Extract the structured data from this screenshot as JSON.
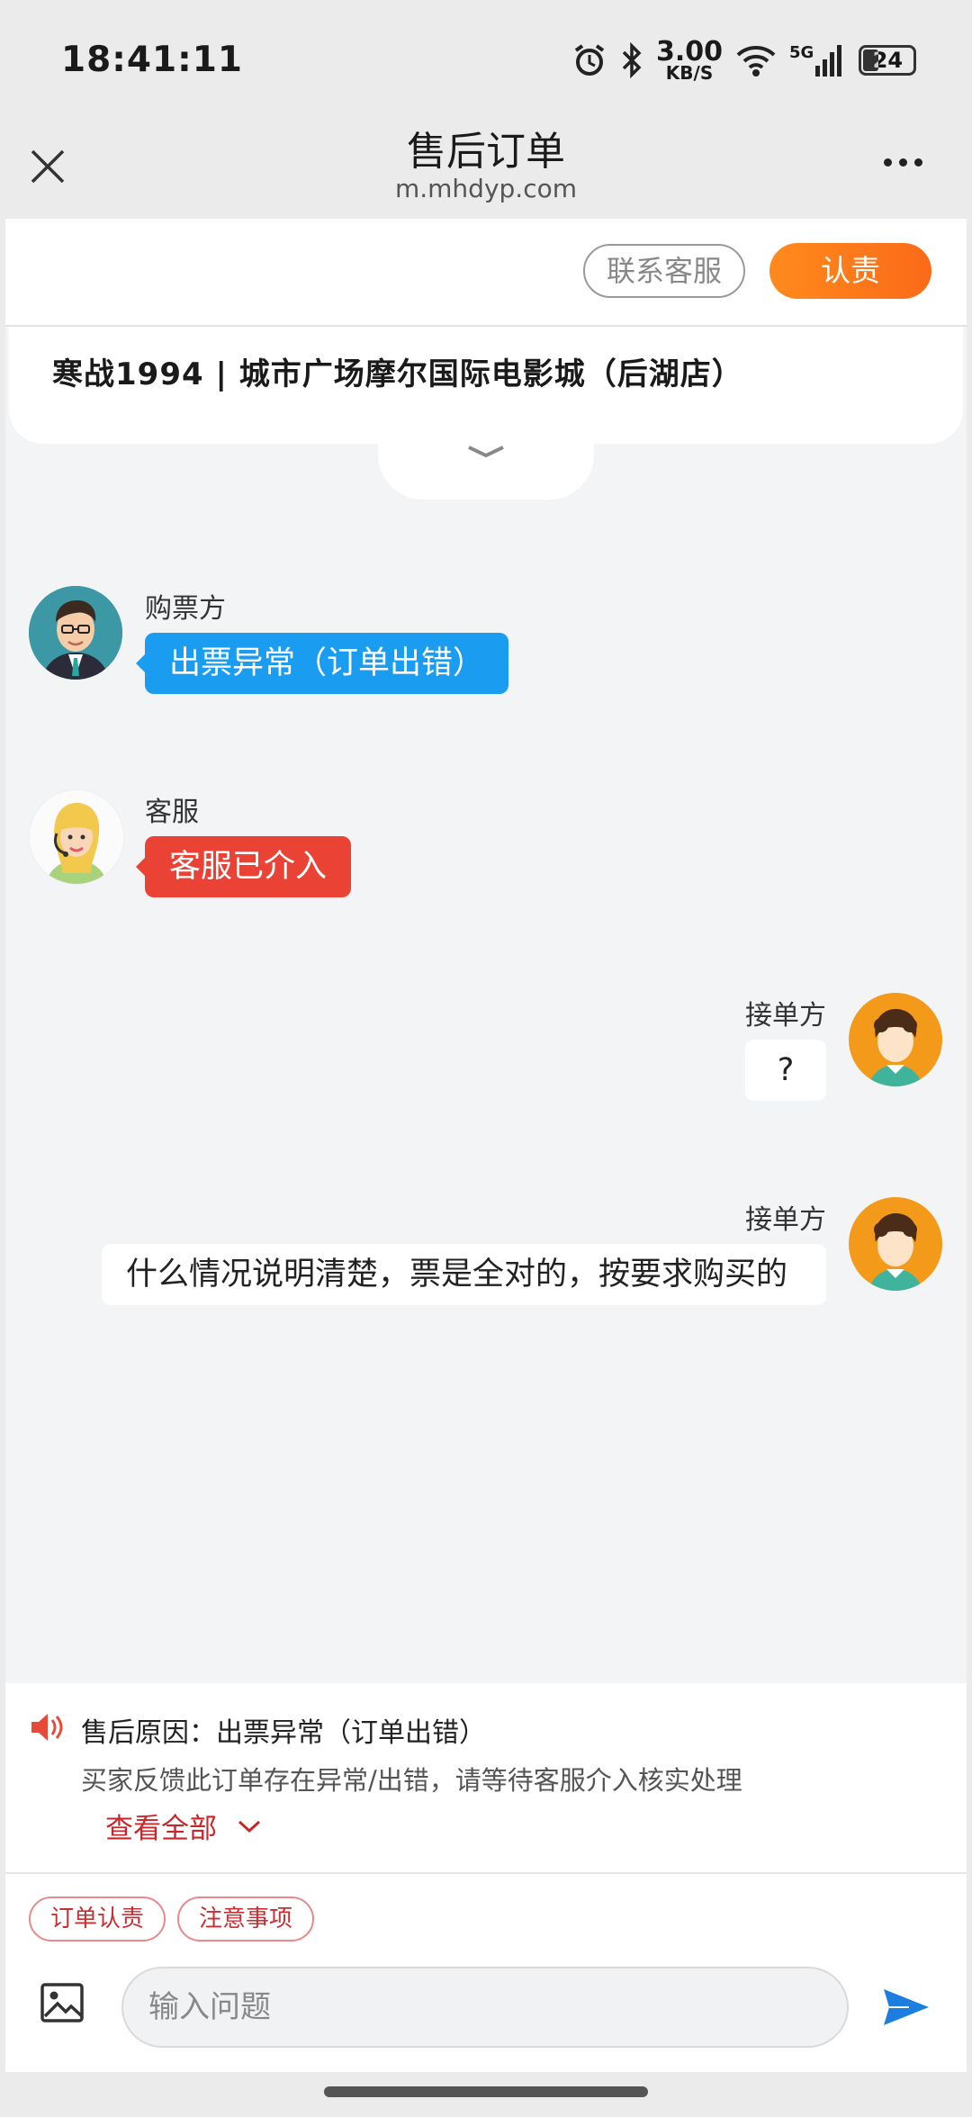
{
  "status_bar": {
    "time": "18:41:11",
    "net_speed": "3.00",
    "net_unit": "KB/S",
    "network": "5G",
    "battery": "24"
  },
  "header": {
    "title": "售后订单",
    "domain": "m.mhdyp.com"
  },
  "actions": {
    "contact": "联系客服",
    "accept": "认责"
  },
  "movie": {
    "title": "寒战1994 | 城市广场摩尔国际电影城（后湖店）"
  },
  "messages": [
    {
      "sender": "购票方",
      "text": "出票异常（订单出错）",
      "side": "left",
      "color": "#1a9cf0"
    },
    {
      "sender": "客服",
      "text": "客服已介入",
      "side": "left",
      "color": "#ea4336"
    },
    {
      "sender": "接单方",
      "text": "?",
      "side": "right",
      "color": "#ffffff"
    },
    {
      "sender": "接单方",
      "text": "什么情况说明清楚，票是全对的，按要求购买的",
      "side": "right",
      "color": "#ffffff"
    }
  ],
  "notice": {
    "reason_label": "售后原因：出票异常（订单出错）",
    "description": "买家反馈此订单存在异常/出错，请等待客服介入核实处理",
    "view_all": "查看全部"
  },
  "tags": [
    "订单认责",
    "注意事项"
  ],
  "input": {
    "placeholder": "输入问题"
  },
  "colors": {
    "accent_orange": "#fb6a18",
    "blue": "#1a9cf0",
    "red": "#ea4336",
    "send": "#1e7ee0"
  }
}
